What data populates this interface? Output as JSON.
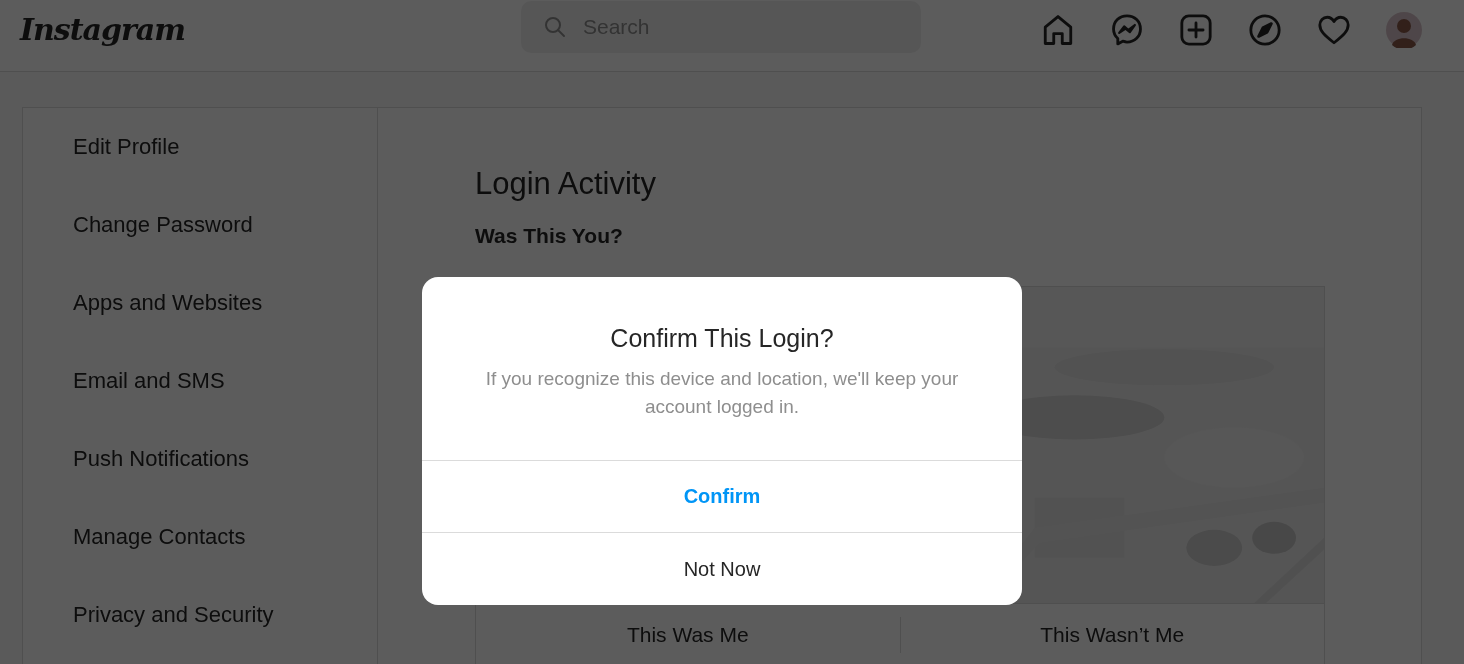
{
  "header": {
    "logo": "Instagram",
    "search": {
      "placeholder": "Search"
    }
  },
  "sidebar": {
    "items": [
      {
        "label": "Edit Profile",
        "selected": false
      },
      {
        "label": "Change Password",
        "selected": false
      },
      {
        "label": "Apps and Websites",
        "selected": false
      },
      {
        "label": "Email and SMS",
        "selected": false
      },
      {
        "label": "Push Notifications",
        "selected": false
      },
      {
        "label": "Manage Contacts",
        "selected": false
      },
      {
        "label": "Privacy and Security",
        "selected": false
      }
    ]
  },
  "main": {
    "title": "Login Activity",
    "subtitle": "Was This You?",
    "actions": [
      {
        "label": "This Was Me"
      },
      {
        "label": "This Wasn’t Me"
      }
    ]
  },
  "dialog": {
    "title": "Confirm This Login?",
    "message": "If you recognize this device and location, we'll keep your account logged in.",
    "buttons": [
      {
        "label": "Confirm",
        "kind": "primary"
      },
      {
        "label": "Not Now",
        "kind": "secondary"
      }
    ]
  }
}
